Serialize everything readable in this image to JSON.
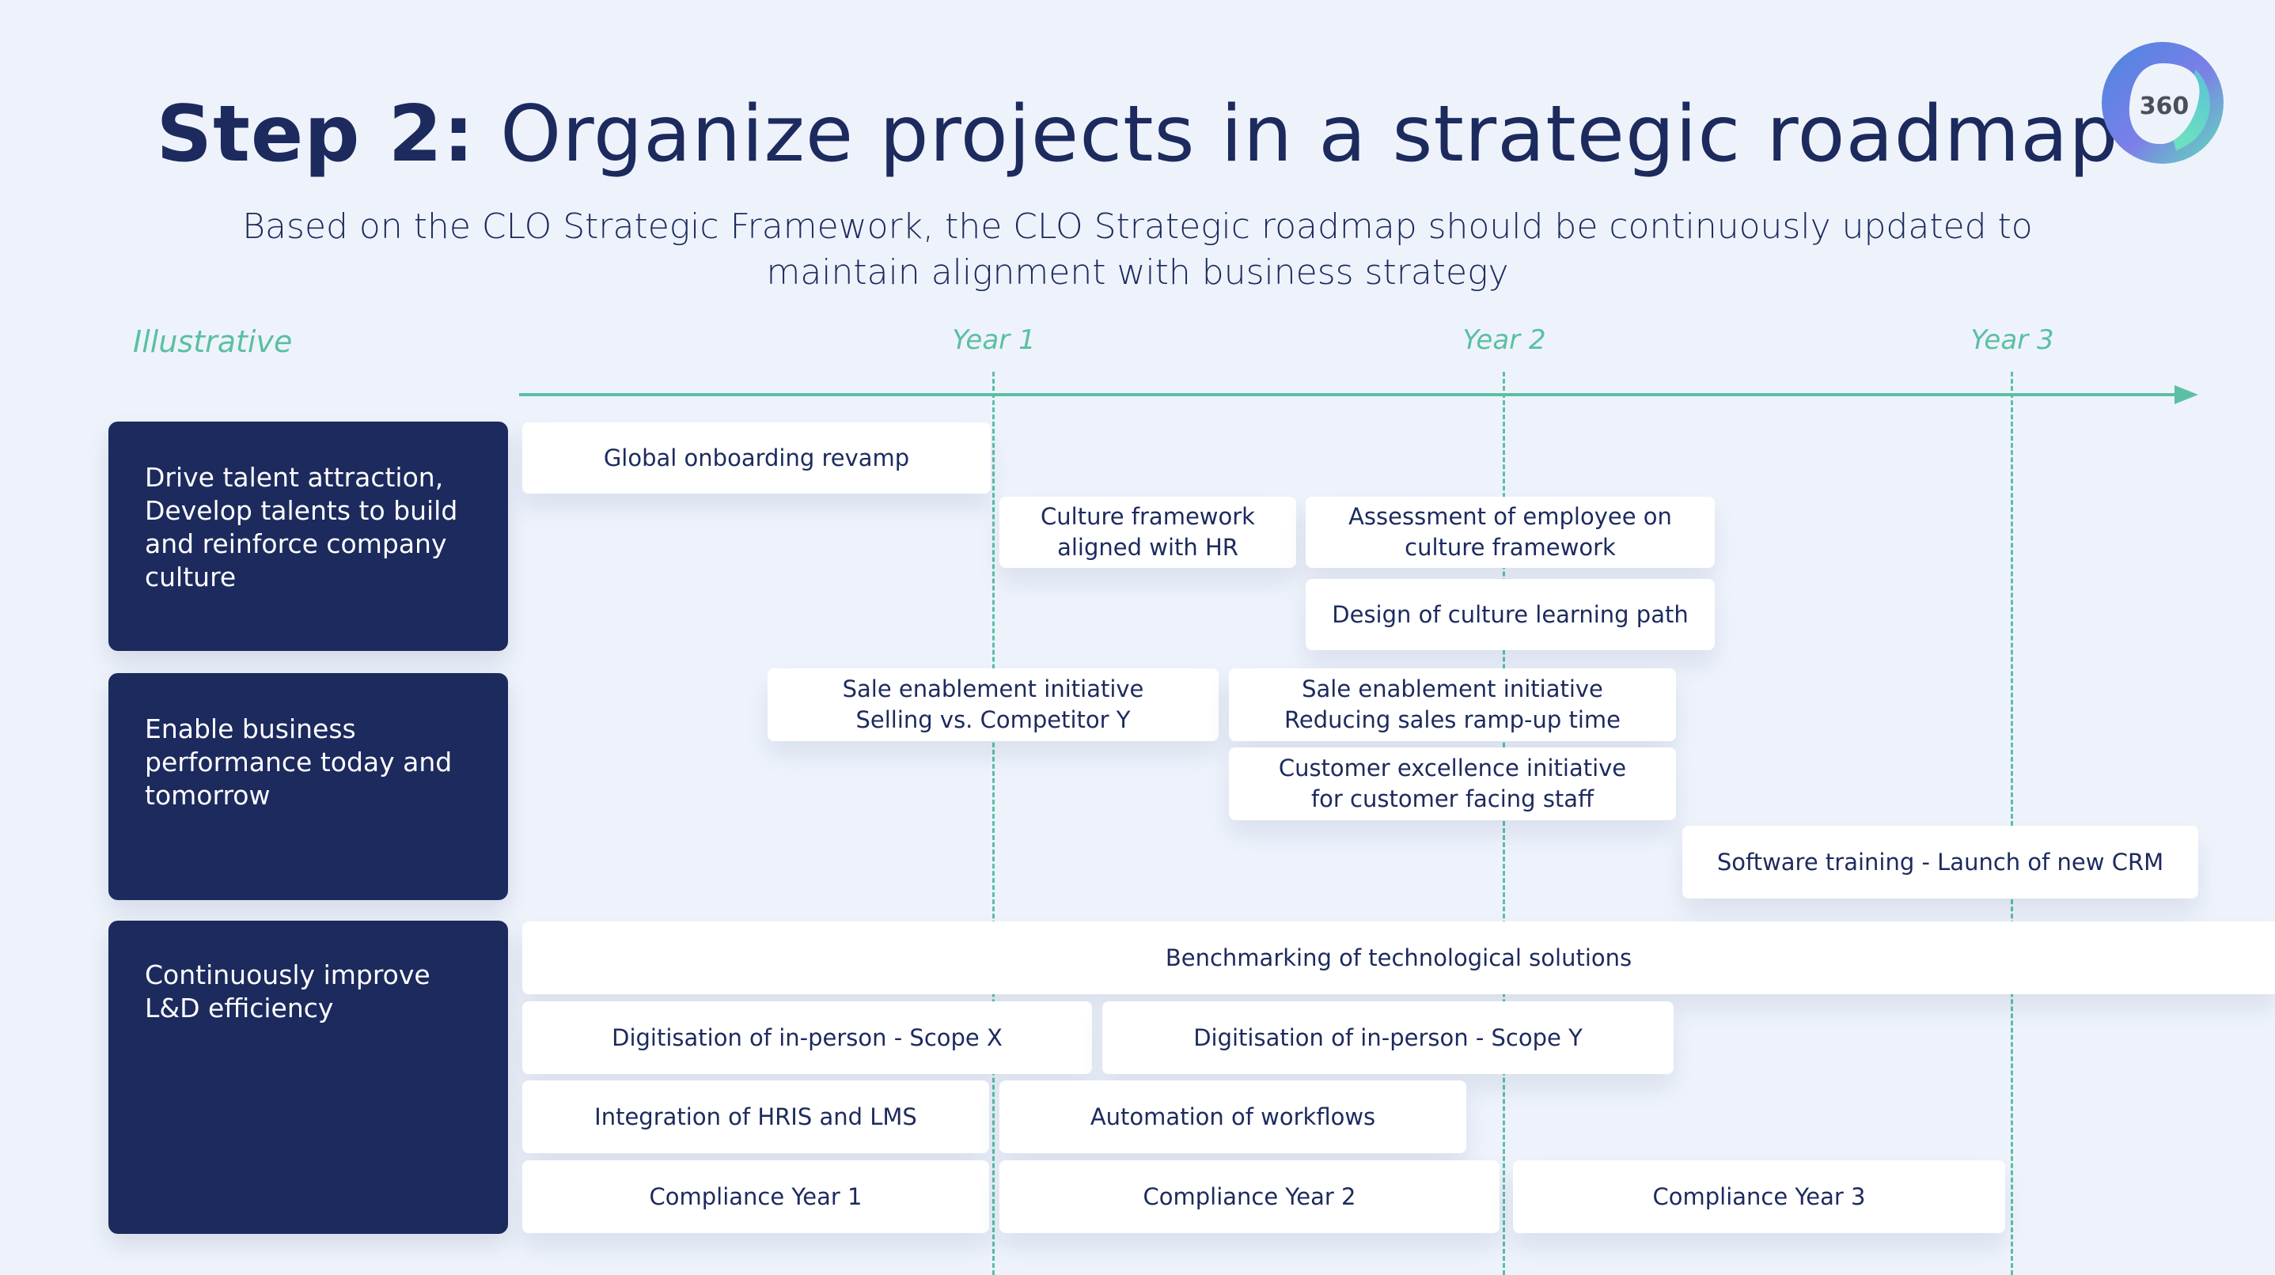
{
  "header": {
    "title_bold": "Step 2:",
    "title_rest": " Organize projects in a strategic roadmap",
    "subtitle_line1": "Based on the CLO Strategic Framework, the CLO Strategic roadmap should be continuously updated to",
    "subtitle_line2": "maintain alignment with business strategy",
    "logo_text": "360"
  },
  "timeline": {
    "tag": "Illustrative",
    "years": [
      "Year 1",
      "Year 2",
      "Year 3"
    ],
    "accent_color": "#5bbfa5"
  },
  "goals": [
    {
      "label": "Drive talent attraction, Develop talents to build and reinforce company culture",
      "projects": [
        {
          "label": "Global onboarding revamp"
        },
        {
          "label": "Culture framework aligned with HR"
        },
        {
          "label": "Assessment of employee on culture framework"
        },
        {
          "label": "Design of culture learning path"
        }
      ]
    },
    {
      "label": "Enable business performance today and tomorrow",
      "projects": [
        {
          "label": "Sale enablement initiative Selling vs. Competitor Y"
        },
        {
          "label": "Sale enablement initiative Reducing sales ramp-up time"
        },
        {
          "label": "Customer excellence initiative for customer facing staff"
        },
        {
          "label": "Software training - Launch of new CRM"
        }
      ]
    },
    {
      "label": "Continuously improve L&D efficiency",
      "projects": [
        {
          "label": "Benchmarking of technological solutions"
        },
        {
          "label": "Digitisation of in-person - Scope X"
        },
        {
          "label": "Digitisation of in-person - Scope Y"
        },
        {
          "label": "Integration of HRIS and LMS"
        },
        {
          "label": "Automation of workflows"
        },
        {
          "label": "Compliance Year 1"
        },
        {
          "label": "Compliance Year 2"
        },
        {
          "label": "Compliance Year 3"
        }
      ]
    }
  ],
  "colors": {
    "navy": "#1c2a5e",
    "background": "#eef3fb",
    "card": "#ffffff",
    "accent": "#5bbfa5"
  }
}
